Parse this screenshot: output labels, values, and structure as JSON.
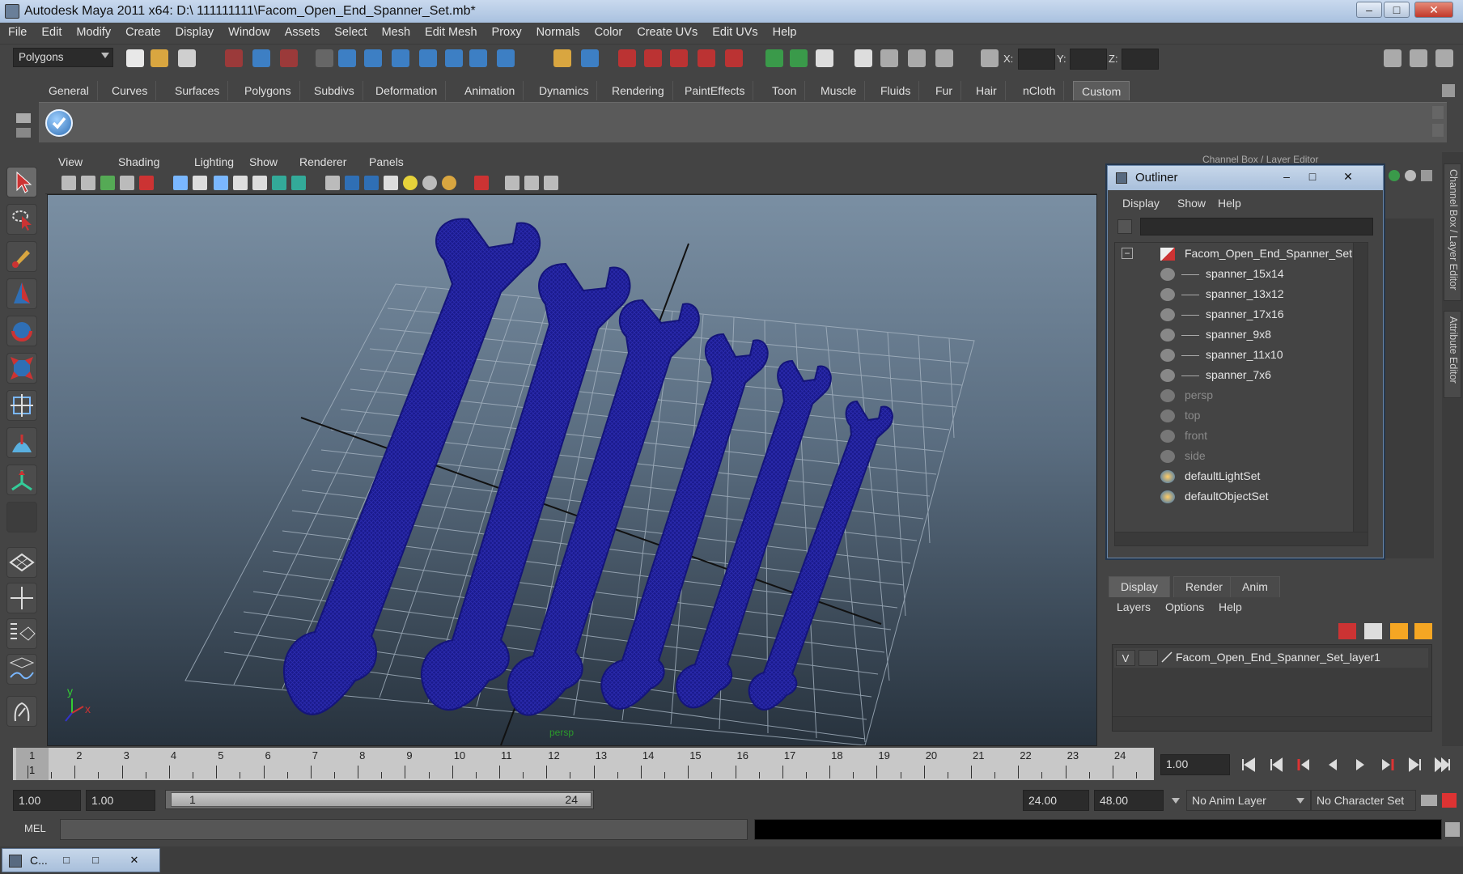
{
  "titlebar": {
    "title": "Autodesk Maya 2011 x64: D:\\ 111111111\\Facom_Open_End_Spanner_Set.mb*",
    "minimize": "–",
    "maximize": "□",
    "close": "✕"
  },
  "menubar": [
    "File",
    "Edit",
    "Modify",
    "Create",
    "Display",
    "Window",
    "Assets",
    "Select",
    "Mesh",
    "Edit Mesh",
    "Proxy",
    "Normals",
    "Color",
    "Create UVs",
    "Edit UVs",
    "Help"
  ],
  "statusline": {
    "menuset": "Polygons",
    "x_label": "X:",
    "y_label": "Y:",
    "z_label": "Z:"
  },
  "shelf": {
    "tabs": [
      "General",
      "Curves",
      "Surfaces",
      "Polygons",
      "Subdivs",
      "Deformation",
      "Animation",
      "Dynamics",
      "Rendering",
      "PaintEffects",
      "Toon",
      "Muscle",
      "Fluids",
      "Fur",
      "Hair",
      "nCloth",
      "Custom"
    ],
    "active_tab": "Custom"
  },
  "viewport": {
    "menus": [
      "View",
      "Shading",
      "Lighting",
      "Show",
      "Renderer",
      "Panels"
    ],
    "camera_label": "persp",
    "axis_y": "y",
    "axis_x": "x"
  },
  "channelbox": {
    "header": "Channel Box / Layer Editor",
    "vtab_channel": "Channel Box / Layer Editor",
    "vtab_attr": "Attribute Editor"
  },
  "outliner": {
    "title": "Outliner",
    "menus": [
      "Display",
      "Show",
      "Help"
    ],
    "root": "Facom_Open_End_Spanner_Set",
    "children": [
      "spanner_15x14",
      "spanner_13x12",
      "spanner_17x16",
      "spanner_9x8",
      "spanner_11x10",
      "spanner_7x6"
    ],
    "cameras": [
      "persp",
      "top",
      "front",
      "side"
    ],
    "sets": [
      "defaultLightSet",
      "defaultObjectSet"
    ],
    "expander": "−"
  },
  "layers": {
    "tabs": [
      "Display",
      "Render",
      "Anim"
    ],
    "active_tab": "Display",
    "menus": [
      "Layers",
      "Options",
      "Help"
    ],
    "layer_name": "Facom_Open_End_Spanner_Set_layer1",
    "visibility": "V"
  },
  "timeslider": {
    "frames": [
      "1",
      "2",
      "3",
      "4",
      "5",
      "6",
      "7",
      "8",
      "9",
      "10",
      "11",
      "12",
      "13",
      "14",
      "15",
      "16",
      "17",
      "18",
      "19",
      "20",
      "21",
      "22",
      "23",
      "24"
    ],
    "current_frame_marker": "1",
    "current_frame": "1.00"
  },
  "range": {
    "start": "1.00",
    "playback_start": "1.00",
    "slider_start": "1",
    "slider_end": "24",
    "playback_end": "24.00",
    "end": "48.00",
    "anim_layer": "No Anim Layer",
    "character_set": "No Character Set"
  },
  "cmdline": {
    "label": "MEL"
  },
  "minibar": {
    "title": "C..."
  },
  "colors": {
    "wireframe": "#1a1a8c",
    "grid": "#9aa8b5",
    "accent_blue": "#2f6fb5"
  }
}
